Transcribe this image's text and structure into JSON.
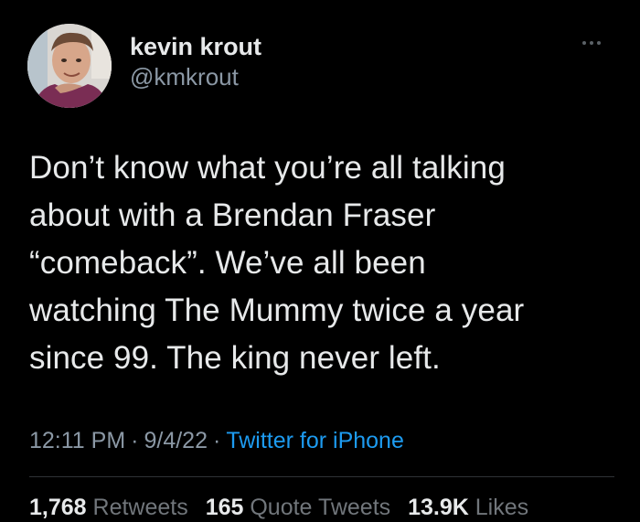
{
  "author": {
    "display_name": "kevin krout",
    "handle": "@kmkrout",
    "avatar_icon": "profile-photo-avatar"
  },
  "menu": {
    "more_icon": "ellipsis-icon"
  },
  "tweet": {
    "text": "Don’t know what you’re all talking\nabout with a Brendan Fraser\n“comeback”. We’ve all been\nwatching The Mummy twice a year\nsince 99. The king never left."
  },
  "meta": {
    "time": "12:11 PM",
    "separator": "·",
    "date": "9/4/22",
    "source": "Twitter for iPhone"
  },
  "stats": {
    "retweets_count": "1,768",
    "retweets_label": "Retweets",
    "quotes_count": "165",
    "quotes_label": "Quote Tweets",
    "likes_count": "13.9K",
    "likes_label": "Likes"
  },
  "colors": {
    "background": "#000000",
    "text": "#e7e9ea",
    "secondary": "#8b98a5",
    "link": "#1d9bf0",
    "divider": "#2f3336"
  }
}
